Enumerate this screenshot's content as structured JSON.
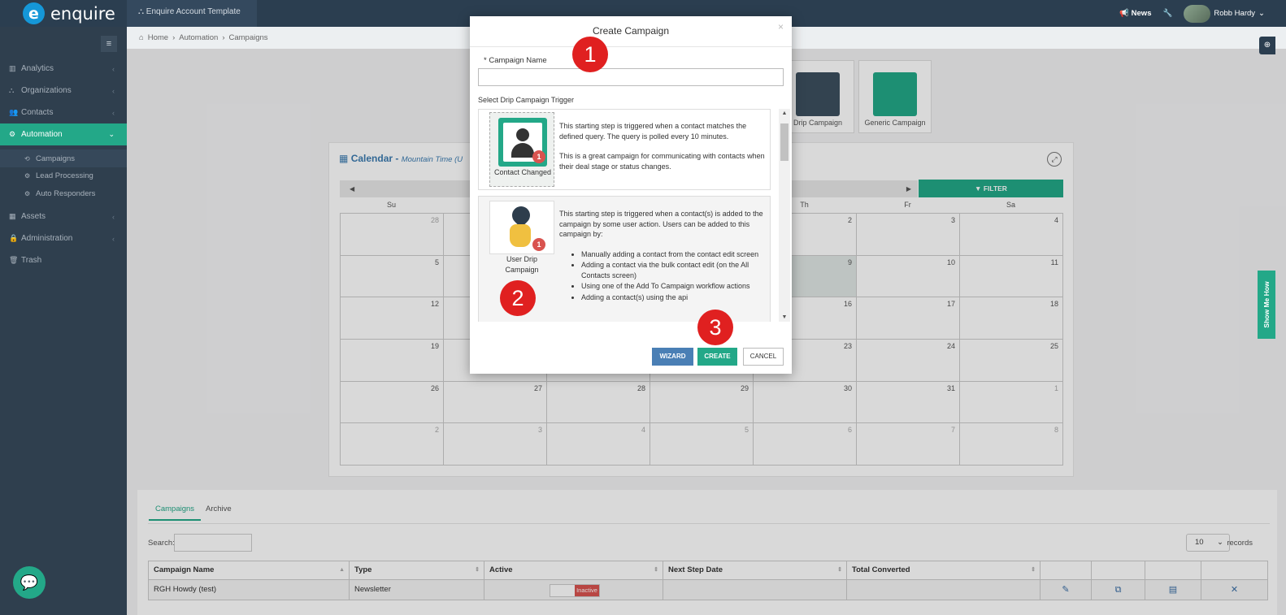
{
  "app": {
    "brand": "enquire",
    "account": "Enquire Account Template"
  },
  "topbar": {
    "news": "News",
    "user": "Robb Hardy"
  },
  "sidebar": {
    "items": [
      {
        "label": "Analytics"
      },
      {
        "label": "Organizations"
      },
      {
        "label": "Contacts"
      },
      {
        "label": "Automation"
      },
      {
        "label": "Assets"
      },
      {
        "label": "Administration"
      },
      {
        "label": "Trash"
      }
    ],
    "subitems": [
      {
        "label": "Campaigns"
      },
      {
        "label": "Lead Processing"
      },
      {
        "label": "Auto Responders"
      }
    ]
  },
  "breadcrumb": {
    "home": "Home",
    "section": "Automation",
    "page": "Campaigns"
  },
  "tiles": {
    "drip": "Drip Campaign",
    "generic": "Generic Campaign"
  },
  "calendar": {
    "title": "Calendar -",
    "timezone": "Mountain Time (U",
    "filter": "FILTER",
    "days": [
      "Su",
      "",
      "",
      "",
      "Th",
      "Fr",
      "Sa"
    ],
    "rows": [
      [
        "28",
        "",
        "",
        "",
        "2",
        "3",
        "4"
      ],
      [
        "5",
        "",
        "",
        "",
        "9",
        "10",
        "11"
      ],
      [
        "12",
        "",
        "",
        "",
        "16",
        "17",
        "18"
      ],
      [
        "19",
        "",
        "",
        "",
        "23",
        "24",
        "25"
      ],
      [
        "26",
        "27",
        "28",
        "29",
        "30",
        "31",
        "1"
      ],
      [
        "2",
        "3",
        "4",
        "5",
        "6",
        "7",
        "8"
      ]
    ]
  },
  "bottom": {
    "tabs": [
      "Campaigns",
      "Archive"
    ],
    "search_label": "Search:",
    "page_size": "10",
    "records_label": "records",
    "columns": [
      "Campaign Name",
      "Type",
      "Active",
      "Next Step Date",
      "Total Converted"
    ],
    "row": {
      "name": "RGH Howdy (test)",
      "type": "Newsletter",
      "active": "Inactive"
    }
  },
  "modal": {
    "title": "Create Campaign",
    "close": "×",
    "name_label": "* Campaign Name",
    "name_value": "",
    "trigger_label": "Select Drip Campaign Trigger",
    "card1": {
      "caption": "Contact Changed",
      "badge": "1",
      "p1": "This starting step is triggered when a contact matches the defined query. The query is polled every 10 minutes.",
      "p2": "This is a great campaign for communicating with contacts when their deal stage or status changes."
    },
    "card2": {
      "caption": "User Drip Campaign",
      "badge": "1",
      "p1": "This starting step is triggered when a contact(s) is added to the campaign by some user action. Users can be added to this campaign by:",
      "bullets": [
        "Manually adding a contact from the contact edit screen",
        "Adding a contact via the bulk contact edit (on the All Contacts screen)",
        "Using one of the Add To Campaign workflow actions",
        "Adding a contact(s) using the api"
      ]
    },
    "buttons": {
      "wizard": "WIZARD",
      "create": "CREATE",
      "cancel": "CANCEL"
    }
  },
  "markers": [
    "1",
    "2",
    "3"
  ],
  "show_me_how": "Show Me How",
  "colors": {
    "brand": "#23a888",
    "nav_bg": "#2b3e50",
    "danger": "#d9534f",
    "wizard": "#4a7fb5"
  }
}
